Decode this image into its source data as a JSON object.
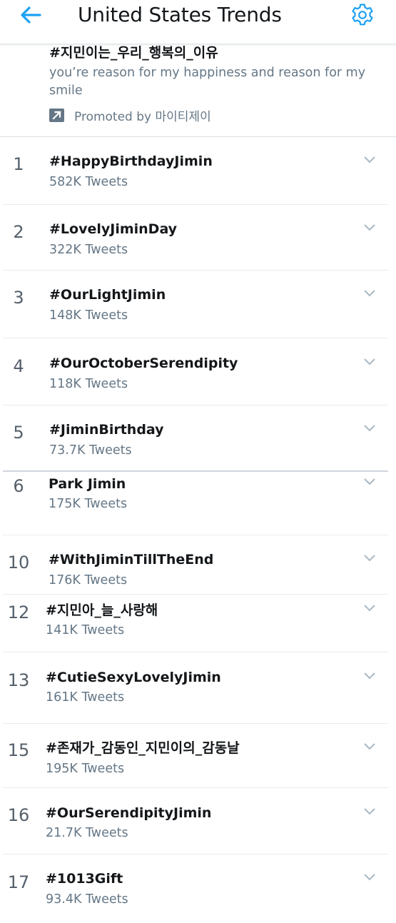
{
  "header": {
    "title": "United States Trends",
    "back_icon": "arrow-left-icon",
    "settings_icon": "gear-icon",
    "accent_color": "#1da1f2"
  },
  "promoted": {
    "hashtag": "#지민이는_우리_행복의_이유",
    "description": "you’re reason for my happiness and reason for my smile",
    "promoted_by": "Promoted by 마이티제이",
    "icon": "promoted-arrow-icon"
  },
  "trends": [
    {
      "rank": "1",
      "name": "#HappyBirthdayJimin",
      "count": "582K Tweets"
    },
    {
      "rank": "2",
      "name": "#LovelyJiminDay",
      "count": "322K Tweets"
    },
    {
      "rank": "3",
      "name": "#OurLightJimin",
      "count": "148K Tweets"
    },
    {
      "rank": "4",
      "name": "#OurOctoberSerendipity",
      "count": "118K Tweets"
    },
    {
      "rank": "5",
      "name": "#JiminBirthday",
      "count": "73.7K Tweets"
    },
    {
      "rank": "6",
      "name": "Park Jimin",
      "count": "175K Tweets"
    },
    {
      "rank": "10",
      "name": "#WithJiminTillTheEnd",
      "count": "176K Tweets"
    },
    {
      "rank": "12",
      "name": "#지민아_늘_사랑해",
      "count": "141K Tweets"
    },
    {
      "rank": "13",
      "name": "#CutieSexyLovelyJimin",
      "count": "161K Tweets"
    },
    {
      "rank": "15",
      "name": "#존재가_감동인_지민이의_감동날",
      "count": "195K Tweets"
    },
    {
      "rank": "16",
      "name": "#OurSerendipityJimin",
      "count": "21.7K Tweets"
    },
    {
      "rank": "17",
      "name": "#1013Gift",
      "count": "93.4K Tweets"
    }
  ]
}
